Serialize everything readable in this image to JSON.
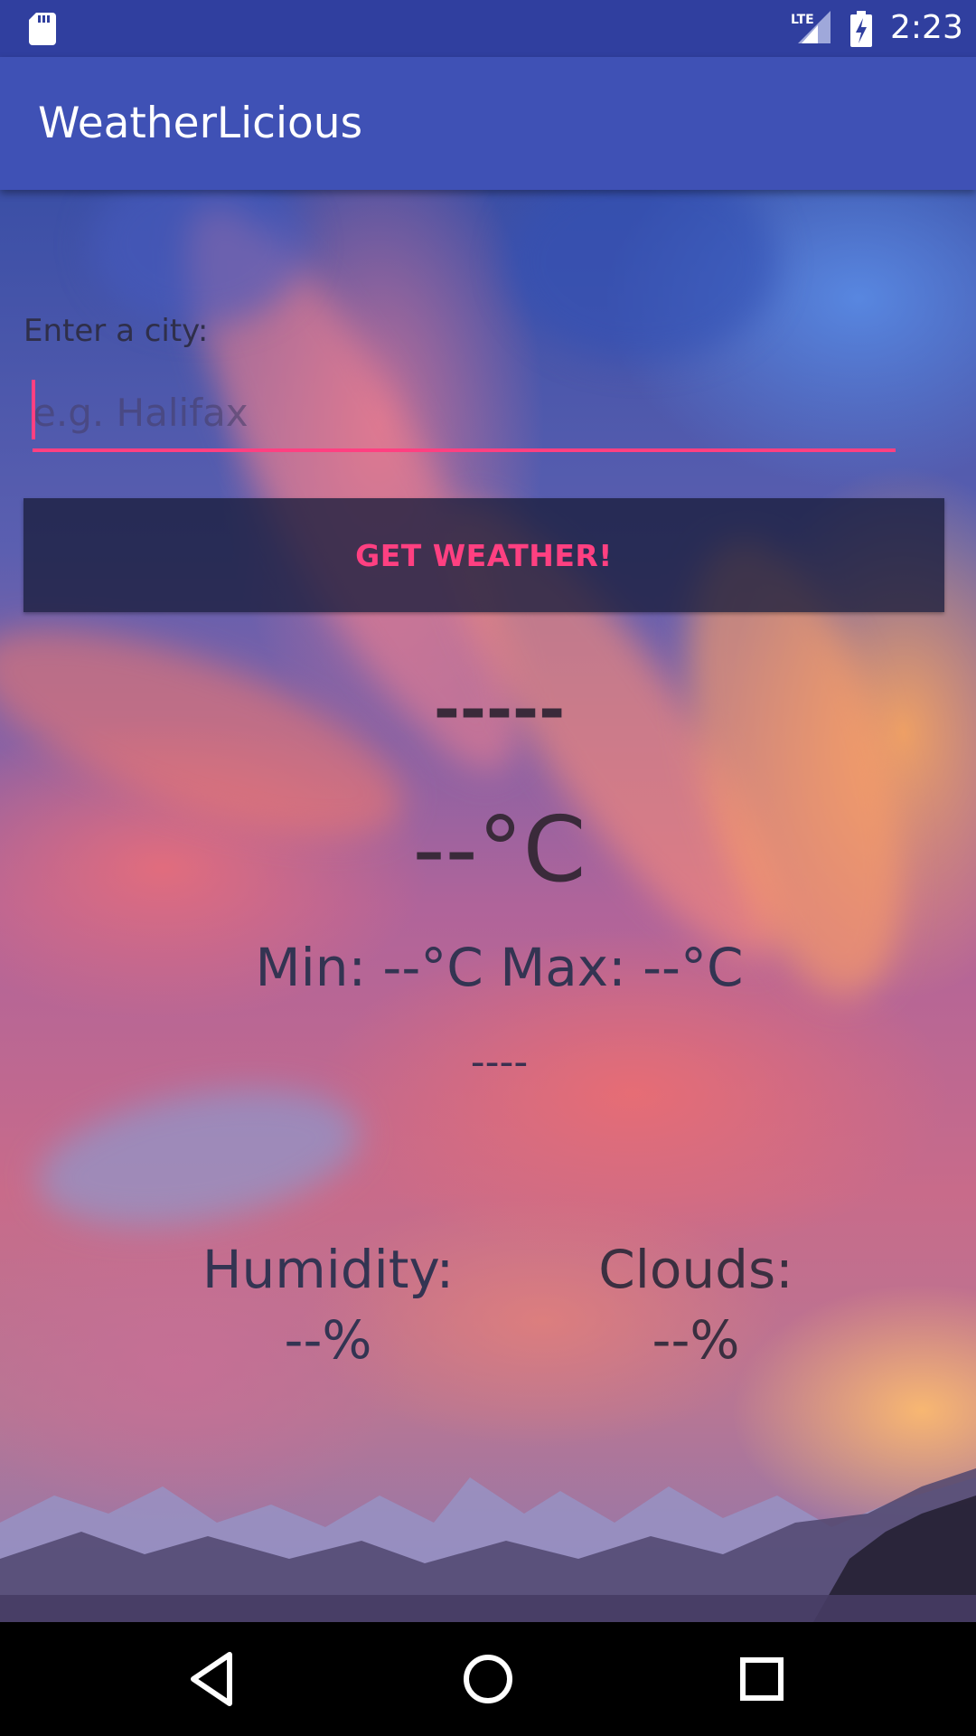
{
  "status_bar": {
    "time": "2:23",
    "network": "LTE",
    "icons": [
      "sd-card-icon",
      "lte-signal-icon",
      "battery-charging-icon"
    ]
  },
  "app_bar": {
    "title": "WeatherLicious",
    "color": "#3f51b5"
  },
  "form": {
    "label": "Enter a city:",
    "placeholder": "e.g. Halifax",
    "value": "",
    "button_label": "GET WEATHER!",
    "accent_color": "#ff4081"
  },
  "weather": {
    "city": "-----",
    "temperature": "--°C",
    "minmax": "Min: --°C Max: --°C",
    "description": "----",
    "humidity_label": "Humidity:",
    "humidity_value": "--%",
    "clouds_label": "Clouds:",
    "clouds_value": "--%"
  },
  "nav_bar": {
    "buttons": [
      "back-icon",
      "home-icon",
      "recents-icon"
    ]
  }
}
